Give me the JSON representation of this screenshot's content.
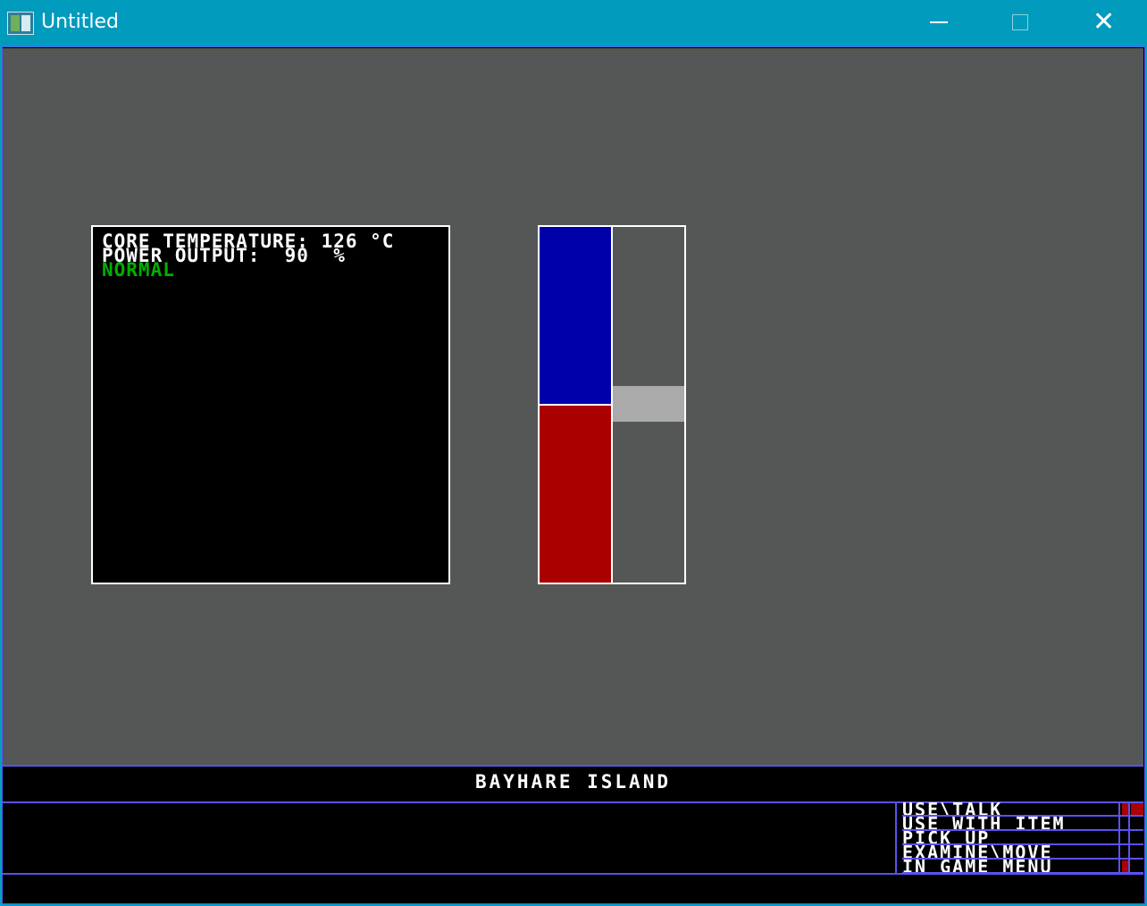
{
  "window": {
    "title": "Untitled",
    "minimize_icon": "minimize-icon",
    "maximize_icon": "maximize-icon",
    "close_icon": "close-icon",
    "close_glyph": "✕"
  },
  "monitor": {
    "line1": "CORE TEMPERATURE: 126 °C",
    "line2": "POWER OUTPUT:  90  %",
    "status": "NORMAL",
    "status_color": "#00b000"
  },
  "gauge": {
    "upper_color": "#0000aa",
    "lower_color": "#aa0000",
    "marker_color": "#aaaaaa"
  },
  "hud": {
    "location": "BAYHARE ISLAND",
    "actions": [
      {
        "label": "USE\\TALK"
      },
      {
        "label": "USE WITH ITEM"
      },
      {
        "label": "PICK UP"
      },
      {
        "label": "EXAMINE\\MOVE"
      },
      {
        "label": "IN GAME MENU"
      }
    ]
  },
  "colors": {
    "scene_bg": "#555756",
    "hud_border": "#5a52f0",
    "titlebar": "#009bbd"
  }
}
